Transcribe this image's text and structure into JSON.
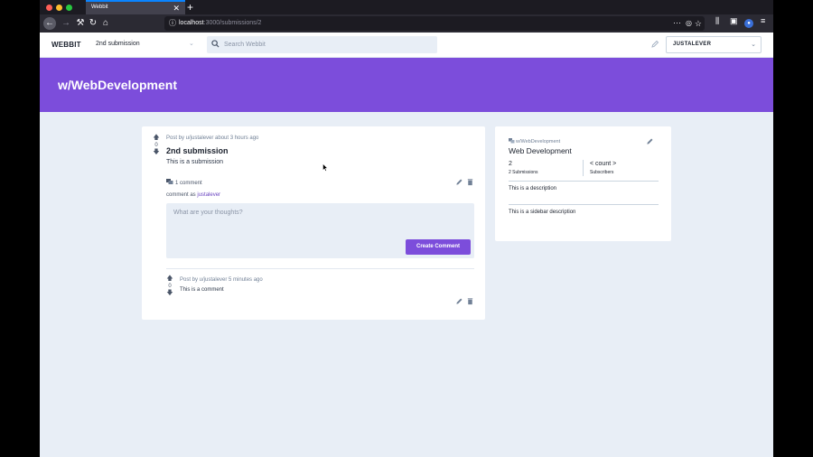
{
  "browser": {
    "tab_title": "Webbit",
    "tab_close": "✕",
    "new_tab": "+",
    "url_host": "localhost",
    "url_rest": ":3000/submissions/2",
    "url_actions": "···"
  },
  "header": {
    "logo": "WEBBIT",
    "context_select": "2nd submission",
    "search_placeholder": "Search Webbit",
    "user_select": "JUSTALEVER"
  },
  "banner": {
    "title": "w/WebDevelopment"
  },
  "post": {
    "vote_count": "0",
    "meta": "Post by u/justalever about 3 hours ago",
    "title": "2nd submission",
    "body": "This is a submission",
    "comment_count": "1 comment",
    "comment_as_label": "comment as",
    "comment_as_user": "justalever",
    "comment_placeholder": "What are your thoughts?",
    "create_comment_label": "Create Comment"
  },
  "comment": {
    "vote_count": "0",
    "meta": "Post by u/justalever 5 minutes ago",
    "body": "This is a comment"
  },
  "sidebar": {
    "community_label": "w/WebDevelopment",
    "community_title": "Web Development",
    "submissions_count": "2",
    "submissions_label": "2 Submissions",
    "subscribers_count": "< count >",
    "subscribers_label": "Subscribers",
    "description": "This is a description",
    "sidebar_description": "This is a sidebar description"
  },
  "colors": {
    "accent": "#7c4ddb",
    "page_bg": "#e8eef6",
    "link": "#6b46c1"
  },
  "icons": [
    "arrow-up-icon",
    "arrow-down-icon",
    "search-icon",
    "pencil-icon",
    "trash-icon",
    "comments-icon",
    "chevron-down-icon",
    "community-icon"
  ]
}
